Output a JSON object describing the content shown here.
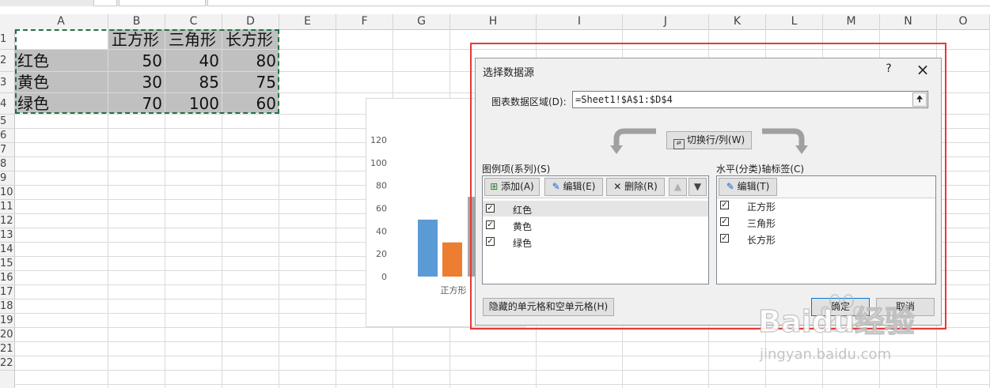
{
  "sheet": {
    "columns": [
      "A",
      "B",
      "C",
      "D",
      "E",
      "F",
      "G",
      "H",
      "I",
      "J",
      "K",
      "L",
      "M",
      "N",
      "O"
    ],
    "rows": [
      "1",
      "2",
      "3",
      "4",
      "5",
      "6",
      "7",
      "8",
      "9",
      "10",
      "11",
      "12",
      "13",
      "14",
      "15",
      "16",
      "17",
      "18",
      "19",
      "20",
      "21",
      "22"
    ],
    "headers": [
      "正方形",
      "三角形",
      "长方形"
    ],
    "data_rows": [
      {
        "label": "红色",
        "values": [
          "50",
          "40",
          "80"
        ]
      },
      {
        "label": "黄色",
        "values": [
          "30",
          "85",
          "75"
        ]
      },
      {
        "label": "绿色",
        "values": [
          "70",
          "100",
          "60"
        ]
      }
    ]
  },
  "chart": {
    "y_ticks": [
      "120",
      "100",
      "80",
      "60",
      "40",
      "20",
      "0"
    ],
    "category_label": "正方形",
    "colors": {
      "series1": "#5b9bd5",
      "series2": "#ed7d31",
      "series3": "#a5a5a5"
    }
  },
  "chart_data": {
    "type": "bar",
    "categories": [
      "正方形",
      "三角形",
      "长方形"
    ],
    "series": [
      {
        "name": "红色",
        "values": [
          50,
          40,
          80
        ]
      },
      {
        "name": "黄色",
        "values": [
          30,
          85,
          75
        ]
      },
      {
        "name": "绿色",
        "values": [
          70,
          100,
          60
        ]
      }
    ],
    "ylim": [
      0,
      120
    ],
    "title": "",
    "xlabel": "",
    "ylabel": ""
  },
  "dialog": {
    "title": "选择数据源",
    "help": "?",
    "close": "×",
    "range_label": "图表数据区域(D):",
    "range_value": "=Sheet1!$A$1:$D$4",
    "switch_label": "切换行/列(W)",
    "legend_title": "图例项(系列)(S)",
    "add_label": "添加(A)",
    "edit_label": "编辑(E)",
    "delete_label": "删除(R)",
    "series_items": [
      "红色",
      "黄色",
      "绿色"
    ],
    "axis_title": "水平(分类)轴标签(C)",
    "axis_edit_label": "编辑(T)",
    "axis_items": [
      "正方形",
      "三角形",
      "长方形"
    ],
    "hidden_cells_label": "隐藏的单元格和空单元格(H)",
    "ok_label": "确定",
    "cancel_label": "取消"
  },
  "watermark": {
    "brand": "Baidu经验",
    "url": "jingyan.baidu.com"
  }
}
